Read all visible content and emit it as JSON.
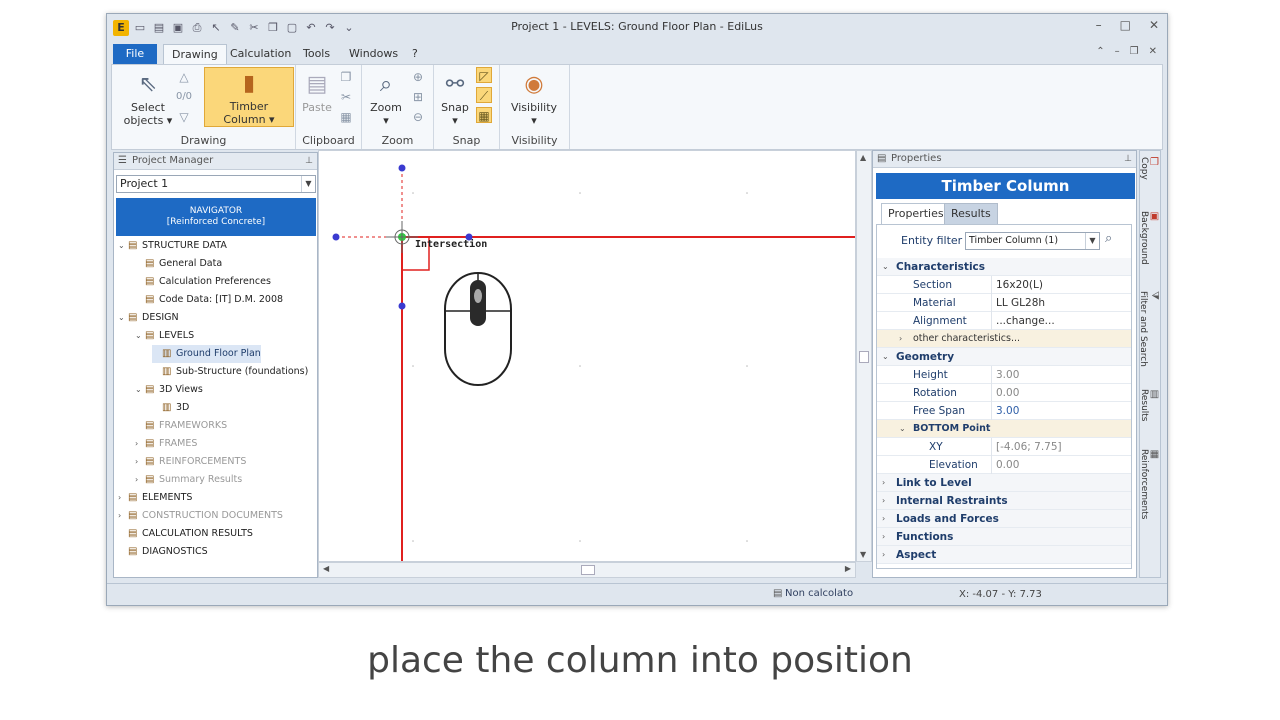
{
  "window": {
    "title": "Project 1 -  LEVELS: Ground Floor Plan - EdiLus",
    "app_logo": "E",
    "controls": [
      "–",
      "□",
      "✕"
    ],
    "mdi_controls": [
      "⌃",
      "–",
      "❐",
      "✕"
    ]
  },
  "menu": {
    "file": "File",
    "tabs": [
      "Drawing",
      "Calculation",
      "Tools",
      "Windows",
      "?"
    ]
  },
  "ribbon": {
    "select_objects": [
      "Select",
      "objects ▾"
    ],
    "counter": "0/0",
    "timber_column": [
      "Timber",
      "Column ▾"
    ],
    "paste": "Paste",
    "zoom": "Zoom",
    "snap": "Snap",
    "visibility": "Visibility",
    "groups": [
      "Drawing",
      "Clipboard",
      "Zoom",
      "Snap",
      "Visibility"
    ]
  },
  "project_manager": {
    "title": "Project Manager",
    "project_select": "Project 1",
    "navigator": [
      "NAVIGATOR",
      "[Reinforced Concrete]"
    ],
    "tree": [
      {
        "label": "STRUCTURE DATA",
        "exp": "⌄",
        "level": 0,
        "state": "normal"
      },
      {
        "label": "General Data",
        "exp": "",
        "level": 1,
        "state": "normal"
      },
      {
        "label": "Calculation Preferences",
        "exp": "",
        "level": 1,
        "state": "normal"
      },
      {
        "label": "Code Data: [IT] D.M. 2008",
        "exp": "",
        "level": 1,
        "state": "normal"
      },
      {
        "label": "DESIGN",
        "exp": "⌄",
        "level": 0,
        "state": "normal"
      },
      {
        "label": "LEVELS",
        "exp": "⌄",
        "level": 1,
        "state": "normal"
      },
      {
        "label": "Ground Floor Plan",
        "exp": "",
        "level": 2,
        "state": "selected"
      },
      {
        "label": "Sub-Structure (foundations)",
        "exp": "",
        "level": 2,
        "state": "normal"
      },
      {
        "label": "3D Views",
        "exp": "⌄",
        "level": 1,
        "state": "normal"
      },
      {
        "label": "3D",
        "exp": "",
        "level": 2,
        "state": "normal"
      },
      {
        "label": "FRAMEWORKS",
        "exp": "",
        "level": 1,
        "state": "disabled"
      },
      {
        "label": "FRAMES",
        "exp": "›",
        "level": 1,
        "state": "disabled"
      },
      {
        "label": "REINFORCEMENTS",
        "exp": "›",
        "level": 1,
        "state": "disabled"
      },
      {
        "label": "Summary Results",
        "exp": "›",
        "level": 1,
        "state": "disabled"
      },
      {
        "label": "ELEMENTS",
        "exp": "›",
        "level": 0,
        "state": "normal"
      },
      {
        "label": "CONSTRUCTION DOCUMENTS",
        "exp": "›",
        "level": 0,
        "state": "disabled"
      },
      {
        "label": "CALCULATION RESULTS",
        "exp": "",
        "level": 0,
        "state": "normal"
      },
      {
        "label": "DIAGNOSTICS",
        "exp": "",
        "level": 0,
        "state": "normal"
      }
    ]
  },
  "canvas": {
    "snap_label": "Intersection"
  },
  "properties": {
    "title": "Properties",
    "entity_title": "Timber Column",
    "tabs": [
      "Properties",
      "Results"
    ],
    "entity_filter_label": "Entity filter",
    "entity_filter_value": "Timber Column (1)",
    "sections": {
      "characteristics": "Characteristics",
      "section_k": "Section",
      "section_v": "16x20(L)",
      "material_k": "Material",
      "material_v": "LL GL28h",
      "alignment_k": "Alignment",
      "alignment_v": "...change...",
      "other": "other characteristics...",
      "geometry": "Geometry",
      "height_k": "Height",
      "height_v": "3.00",
      "rotation_k": "Rotation",
      "rotation_v": "0.00",
      "span_k": "Free Span",
      "span_v": "3.00",
      "bottom": "BOTTOM Point",
      "xy_k": "XY",
      "xy_v": "[-4.06; 7.75]",
      "elev_k": "Elevation",
      "elev_v": "0.00",
      "link": "Link to Level",
      "restraints": "Internal Restraints",
      "loads": "Loads and Forces",
      "functions": "Functions",
      "aspect": "Aspect"
    }
  },
  "sidebar": [
    "Copy",
    "Background",
    "Filter and Search",
    "Results",
    "Reinforcements"
  ],
  "status": {
    "calc": "Non calcolato",
    "coords": "X: -4.07 - Y: 7.73"
  },
  "caption": "place the column into position",
  "colors": {
    "accent": "#1e6ac4",
    "drawing_line": "#e0201f",
    "grip": "#3a3ad0",
    "highlight": "#fbd77a"
  }
}
